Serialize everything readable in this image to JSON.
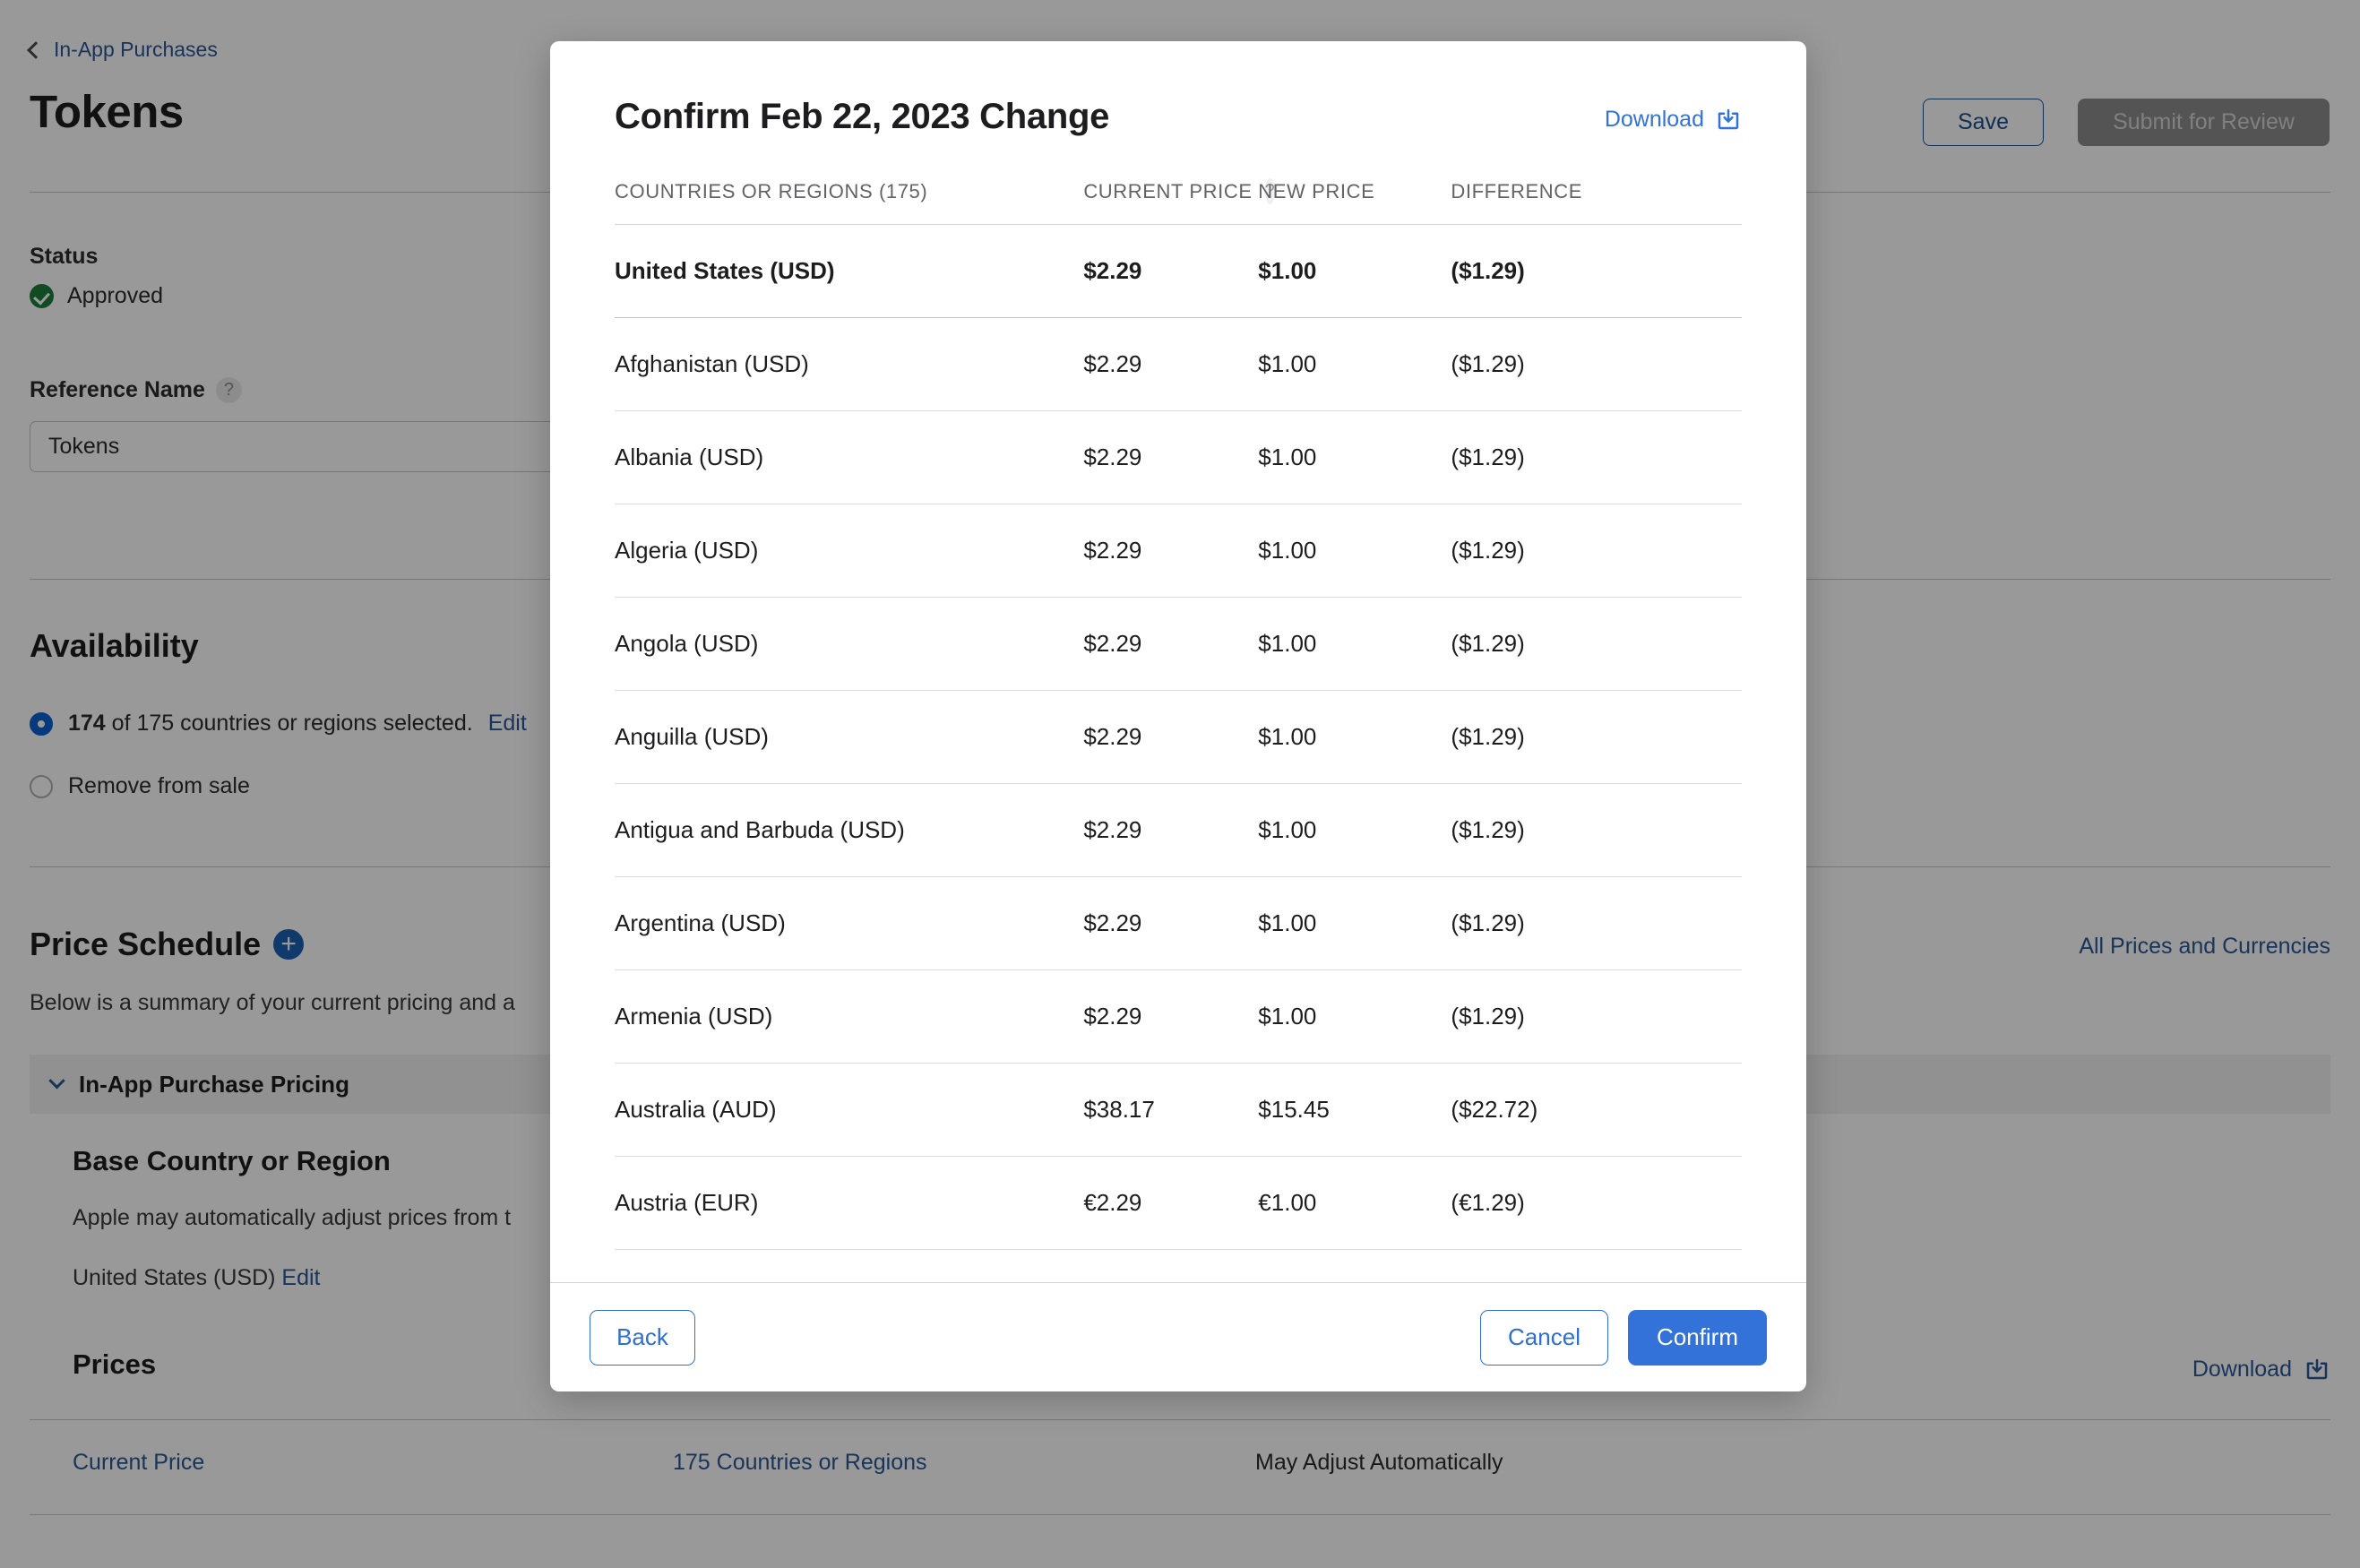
{
  "page": {
    "breadcrumb": "In-App Purchases",
    "title": "Tokens",
    "status_label": "Status",
    "status_value": "Approved",
    "reference_name_label": "Reference Name",
    "reference_name_value": "Tokens",
    "reference_name_help": "?",
    "save_button": "Save",
    "submit_button": "Submit for Review",
    "availability_heading": "Availability",
    "availability_count_bold": "174",
    "availability_count_rest": " of 175 countries or regions selected.",
    "availability_edit": "Edit",
    "remove_from_sale": "Remove from sale",
    "price_schedule_heading": "Price Schedule",
    "price_schedule_add": "+",
    "price_schedule_desc": "Below is a summary of your current pricing and a",
    "accordion_label": "In-App Purchase Pricing",
    "base_country_heading": "Base Country or Region",
    "base_country_desc": "Apple may automatically adjust prices from t",
    "base_country_value": "United States (USD)",
    "base_country_edit": "Edit",
    "prices_heading": "Prices",
    "all_prices_link": "All Prices and Currencies",
    "download_link": "Download",
    "prices_row": {
      "label": "Current Price",
      "countries": "175 Countries or Regions",
      "note": "May Adjust Automatically"
    }
  },
  "modal": {
    "title": "Confirm Feb 22, 2023 Change",
    "download_label": "Download",
    "columns": [
      "COUNTRIES OR REGIONS (175)",
      "CURRENT PRICE",
      "NEW PRICE",
      "DIFFERENCE"
    ],
    "current_price_help": "?",
    "rows": [
      {
        "country": "United States (USD)",
        "current": "$2.29",
        "new": "$1.00",
        "difference": "($1.29)"
      },
      {
        "country": "Afghanistan (USD)",
        "current": "$2.29",
        "new": "$1.00",
        "difference": "($1.29)"
      },
      {
        "country": "Albania (USD)",
        "current": "$2.29",
        "new": "$1.00",
        "difference": "($1.29)"
      },
      {
        "country": "Algeria (USD)",
        "current": "$2.29",
        "new": "$1.00",
        "difference": "($1.29)"
      },
      {
        "country": "Angola (USD)",
        "current": "$2.29",
        "new": "$1.00",
        "difference": "($1.29)"
      },
      {
        "country": "Anguilla (USD)",
        "current": "$2.29",
        "new": "$1.00",
        "difference": "($1.29)"
      },
      {
        "country": "Antigua and Barbuda (USD)",
        "current": "$2.29",
        "new": "$1.00",
        "difference": "($1.29)"
      },
      {
        "country": "Argentina (USD)",
        "current": "$2.29",
        "new": "$1.00",
        "difference": "($1.29)"
      },
      {
        "country": "Armenia (USD)",
        "current": "$2.29",
        "new": "$1.00",
        "difference": "($1.29)"
      },
      {
        "country": "Australia (AUD)",
        "current": "$38.17",
        "new": "$15.45",
        "difference": "($22.72)"
      },
      {
        "country": "Austria (EUR)",
        "current": "€2.29",
        "new": "€1.00",
        "difference": "(€1.29)"
      }
    ],
    "back_button": "Back",
    "cancel_button": "Cancel",
    "confirm_button": "Confirm"
  },
  "colors": {
    "accent_blue": "#3272d9",
    "link_blue": "#2b5797",
    "approved_green": "#1c7d3c",
    "overlay": "rgba(0,0,0,0.40)"
  }
}
